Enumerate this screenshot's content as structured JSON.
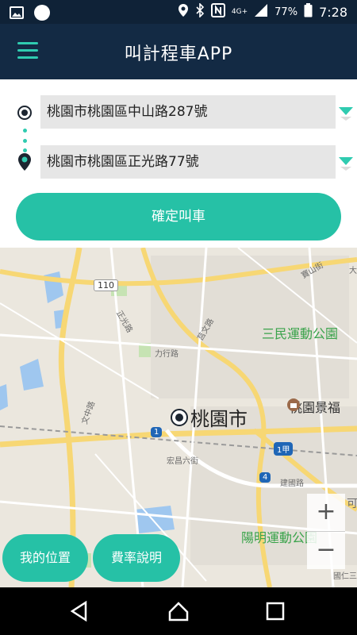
{
  "status_bar": {
    "time": "7:28",
    "battery": "77%",
    "network": "4G+"
  },
  "app_bar": {
    "title": "叫計程車APP",
    "menu_icon": "hamburger-icon"
  },
  "route": {
    "origin": "桃園市桃園區中山路287號",
    "destination": "桃園市桃園區正光路77號",
    "confirm_label": "確定叫車"
  },
  "map": {
    "city_label": "桃園市",
    "parks": [
      "三民運動公園",
      "陽明運動公園"
    ],
    "poi": "桃園景福",
    "roads": [
      "正光路",
      "莒文路",
      "力行路",
      "文中路",
      "宏昌六街",
      "建國路",
      "寶山街"
    ],
    "shields": [
      "1",
      "1甲",
      "4"
    ],
    "route_number": "110",
    "extra_labels": [
      "可",
      "國仁三",
      "大"
    ],
    "zoom_in": "+",
    "zoom_out": "−"
  },
  "buttons": {
    "my_location": "我的位置",
    "fare_info": "費率說明"
  },
  "colors": {
    "accent": "#26c1a6",
    "appbar": "#132a44",
    "statusbar": "#0f2237"
  }
}
